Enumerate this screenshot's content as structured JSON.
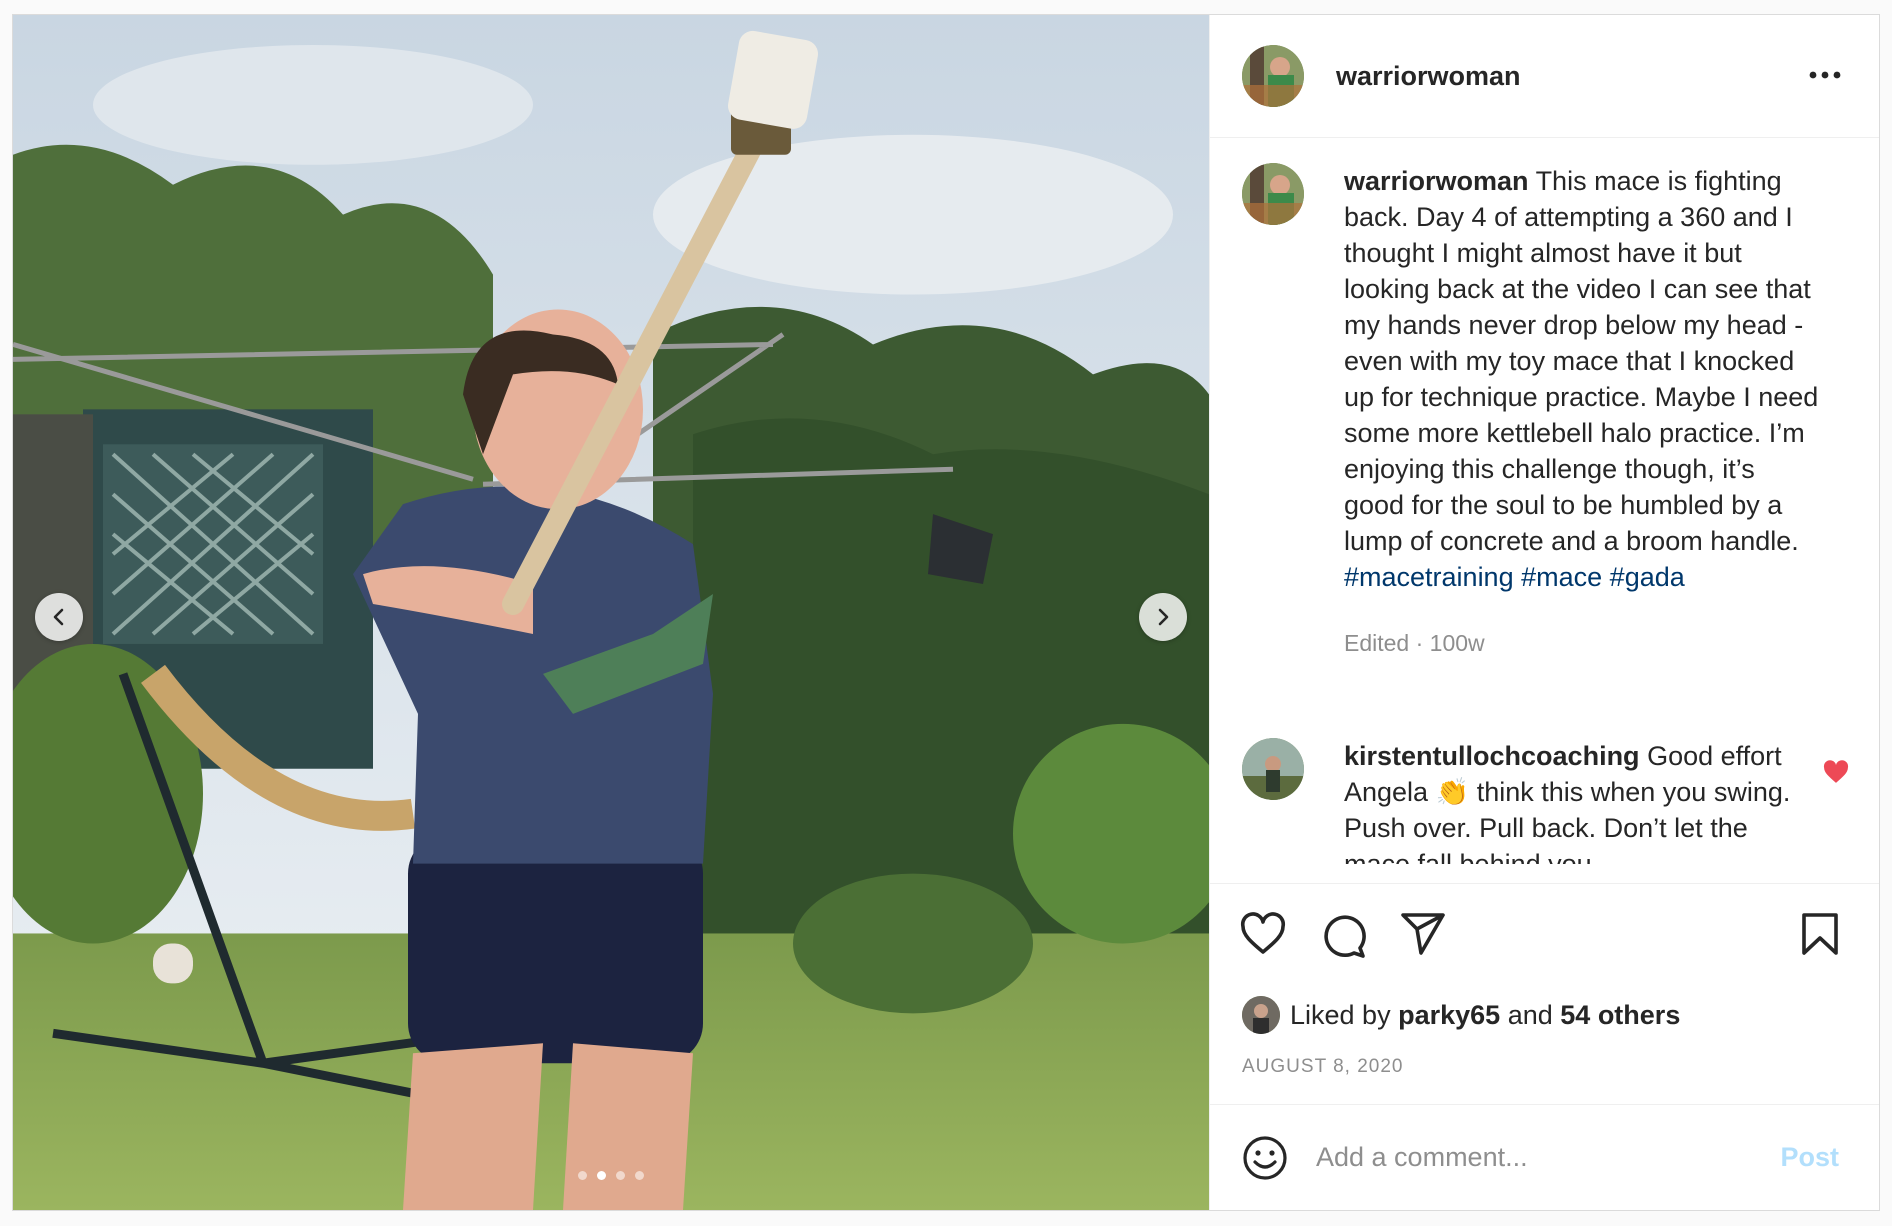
{
  "post": {
    "username": "warriorwoman",
    "more_icon": "more-horizontal-icon",
    "media": {
      "dots_total": 4,
      "active_dot": 2,
      "prev_icon": "chevron-left-icon",
      "next_icon": "chevron-right-icon"
    }
  },
  "caption": {
    "username": "warriorwoman",
    "text": "This mace is fighting back. Day 4 of attempting a 360 and I thought I might almost have it but looking back at the video I can see that my hands never drop below my head - even with my toy mace that I knocked up for technique practice. Maybe I need some more kettlebell halo practice. I’m enjoying this challenge though, it’s good for the soul to be humbled by a lump of concrete and a broom handle.",
    "hashtags": [
      "#macetraining",
      "#mace",
      "#gada"
    ],
    "meta": "Edited · 100w"
  },
  "comments": [
    {
      "username": "kirstentullochcoaching",
      "text": "Good effort Angela 👏 think this when you swing. Push over. Pull back. Don’t let the mace fall behind you.",
      "liked": true,
      "heart_color": "#ed4956"
    }
  ],
  "actions": {
    "like_icon": "heart-icon",
    "comment_icon": "comment-icon",
    "share_icon": "share-icon",
    "save_icon": "bookmark-icon"
  },
  "likes": {
    "prefix": "Liked by",
    "user": "parky65",
    "joiner": "and",
    "others": "54 others"
  },
  "date": "AUGUST 8, 2020",
  "add_comment": {
    "placeholder": "Add a comment...",
    "post_label": "Post",
    "emoji_icon": "emoji-icon"
  },
  "colors": {
    "text": "#262626",
    "muted": "#8e8e8e",
    "hashtag": "#00376b",
    "post_button_disabled": "#b2dffc",
    "like_red": "#ed4956"
  }
}
